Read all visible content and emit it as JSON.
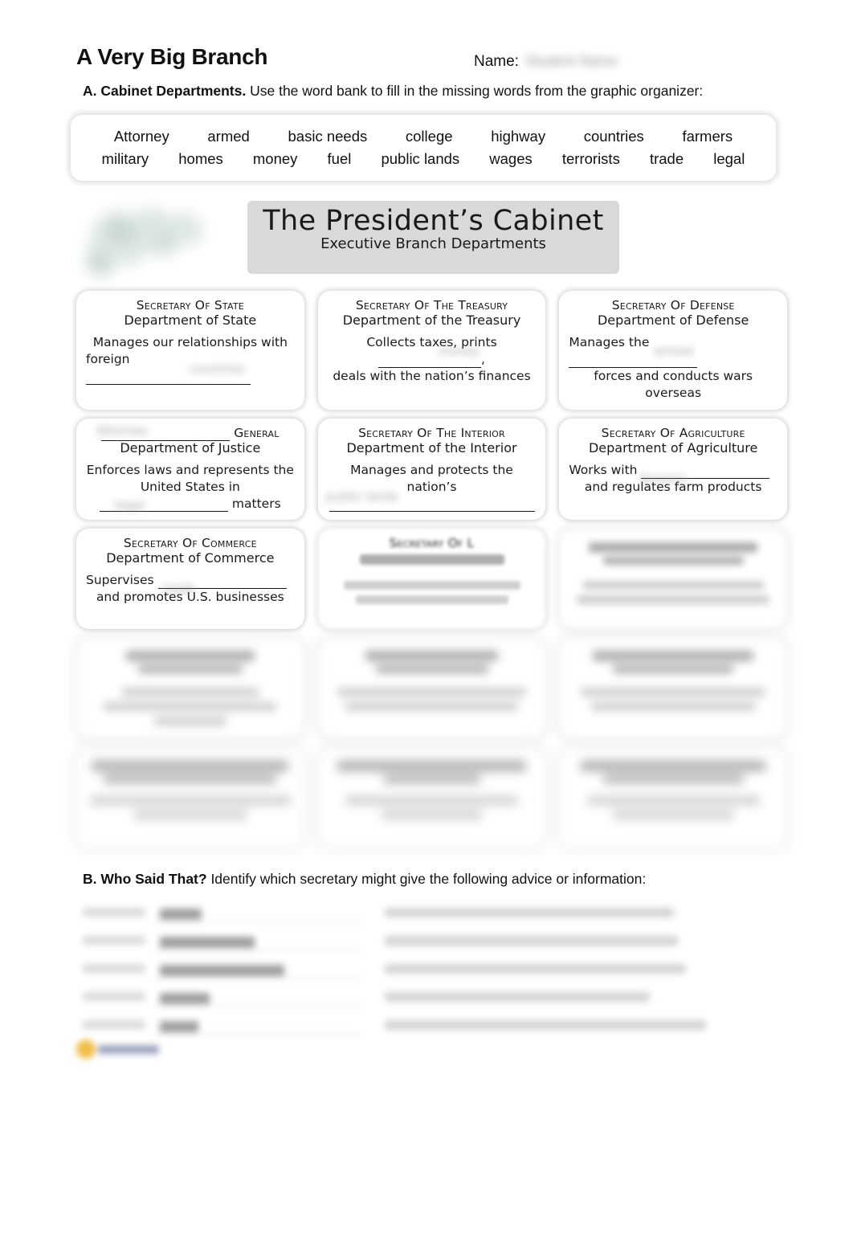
{
  "header": {
    "title": "A Very Big Branch",
    "name_label": "Name:",
    "name_value": "Student Name"
  },
  "sections": {
    "a": {
      "bold": "A. Cabinet Departments.",
      "rest": " Use the word bank to fill in the missing words from the graphic organizer:"
    },
    "b": {
      "bold": "B. Who Said That?",
      "rest": " Identify which secretary might give the following advice or information:"
    }
  },
  "word_bank": {
    "row1": [
      "Attorney",
      "armed",
      "basic needs",
      "college",
      "highway",
      "countries",
      "farmers"
    ],
    "row2": [
      "military",
      "homes",
      "money",
      "fuel",
      "public lands",
      "wages",
      "terrorists",
      "trade",
      "legal"
    ]
  },
  "organizer": {
    "banner_title": "The President’s Cabinet",
    "banner_subtitle": "Executive Branch Departments"
  },
  "cards": {
    "state": {
      "secretary": "Secretary of State",
      "department": "Department of State",
      "line1": "Manages our relationships with",
      "line2_prefix": "foreign",
      "ghost_answer": "countries"
    },
    "treasury": {
      "secretary": "Secretary of the Treasury",
      "department": "Department of the Treasury",
      "line1_prefix": "Collects taxes, prints",
      "line1_suffix": ",",
      "line2": "deals with the nation’s finances",
      "ghost_answer": "money"
    },
    "defense": {
      "secretary": "Secretary of Defense",
      "department": "Department of Defense",
      "line1_prefix": "Manages the",
      "line2": "forces and conducts wars overseas",
      "ghost_answer": "armed"
    },
    "justice": {
      "secretary_suffix": "General",
      "department": "Department of Justice",
      "line1": "Enforces laws and represents the",
      "line2": "United States in",
      "line3_suffix": "matters",
      "ghost_answer": "Attorney",
      "ghost_answer2": "legal"
    },
    "interior": {
      "secretary": "Secretary of the Interior",
      "department": "Department of the Interior",
      "line1": "Manages and protects the nation’s",
      "ghost_answer": "public lands"
    },
    "agriculture": {
      "secretary": "Secretary of Agriculture",
      "department": "Department of Agriculture",
      "line1_prefix": "Works with",
      "line2": "and regulates farm products",
      "ghost_answer": "farmers"
    },
    "commerce": {
      "secretary": "Secretary of Commerce",
      "department": "Department of Commerce",
      "line1_prefix": "Supervises",
      "line2": "and promotes U.S. businesses",
      "ghost_answer": "trade"
    },
    "labor": {
      "secretary": "Secretary of L",
      "locked": true
    },
    "hhs": {
      "locked": true
    },
    "row4": {
      "locked": true
    },
    "row5": {
      "locked": true
    }
  },
  "question_rows": [
    {
      "locked": true
    },
    {
      "locked": true
    },
    {
      "locked": true
    },
    {
      "locked": true
    },
    {
      "locked": true
    }
  ]
}
